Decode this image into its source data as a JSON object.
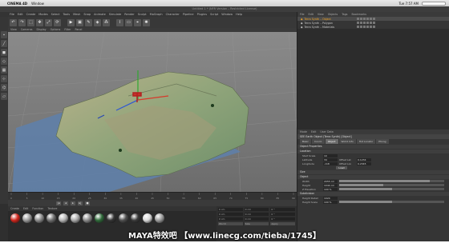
{
  "os_menubar": {
    "app_name": "CINEMA 4D",
    "menu": "Window",
    "time": "Tue 7:57 AM"
  },
  "window": {
    "title": "Untitled 1 * (NFR Version – Restricted License)"
  },
  "main_menu": [
    "File",
    "Edit",
    "Create",
    "Modes",
    "Select",
    "Tools",
    "Mesh",
    "Snap",
    "Animate",
    "Simulate",
    "Render",
    "Sculpt",
    "MoGraph",
    "Character",
    "Pipeline",
    "Plugins",
    "Script",
    "Window",
    "Help"
  ],
  "toolbar_icons": [
    "undo-icon",
    "redo-icon",
    "select-icon",
    "move-icon",
    "scale-icon",
    "rotate-icon",
    "render-icon",
    "cube-icon",
    "pen-icon",
    "subdivide-icon",
    "cloner-icon",
    "deformer-icon",
    "floor-icon",
    "camera-icon",
    "light-icon"
  ],
  "left_tools": [
    "points-icon",
    "edges-icon",
    "polygons-icon",
    "model-icon",
    "texture-icon",
    "axis-icon",
    "snap-icon",
    "workplane-icon"
  ],
  "viewport": {
    "menu": [
      "View",
      "Cameras",
      "Display",
      "Options",
      "Filter",
      "Panel"
    ],
    "label": "Perspective"
  },
  "timeline": {
    "ticks": [
      "0",
      "5",
      "10",
      "15",
      "20",
      "25",
      "30",
      "35",
      "40",
      "45",
      "50",
      "55",
      "60",
      "65",
      "70",
      "75",
      "80",
      "85",
      "90"
    ],
    "start": "0 F",
    "end": "90 F"
  },
  "materials": {
    "menu": [
      "Create",
      "Edit",
      "Function",
      "Texture"
    ],
    "colors": [
      "#d0251c",
      "#9a9a9a",
      "#8c8c8c",
      "#6f6f6f",
      "#b5b5b5",
      "#a8a8a8",
      "#8a8a8a",
      "#2f6a3a",
      "#343434",
      "#4f4f4f",
      "#3a3a3a",
      "#d8d8d8",
      "#9c9c9c"
    ]
  },
  "coordinates": {
    "rows": [
      [
        "0 cm",
        "0 cm",
        "0 °"
      ],
      [
        "0 cm",
        "0 cm",
        "0 °"
      ],
      [
        "0 cm",
        "0 cm",
        "0 °"
      ]
    ],
    "world_label": "World",
    "scale_label": "Size",
    "apply_label": "Apply"
  },
  "object_manager": {
    "menu": [
      "File",
      "Edit",
      "View",
      "Objects",
      "Tags",
      "Bookmarks"
    ],
    "objects": [
      {
        "name": "Terra Synth – Object",
        "selected": true
      },
      {
        "name": "Terra Synth – Polygon",
        "selected": false
      },
      {
        "name": "Terra Synth – Materials",
        "selected": false
      }
    ]
  },
  "attributes": {
    "menu": [
      "Mode",
      "Edit",
      "User Data"
    ],
    "header": "SEE Earth Object (Terra Synth) [Object]",
    "tabs": [
      "Basic",
      "Coord.",
      "Object",
      "World Info",
      "Hot Locator",
      "Phong"
    ],
    "active_tab": "Object",
    "sections": {
      "object_props": "Object Properties",
      "location": "Location",
      "size": "Size",
      "object": "Object",
      "subdivision": "Subdivision"
    },
    "fields": {
      "start_scale": [
        "Start Scale",
        "10"
      ],
      "latitude": [
        "Latitude",
        "34"
      ],
      "longitude": [
        "Longitude",
        "-118"
      ],
      "offset_lat": [
        "Offset Lat",
        "0.1234"
      ],
      "offset_lon": [
        "Offset Lon",
        "0.2345"
      ],
      "width": [
        "Width",
        "2055 cm"
      ],
      "height": [
        "Height",
        "1044 cm"
      ],
      "z_elevation": [
        "Z Elevation",
        "100 %"
      ],
      "height_detail": [
        "Height Detail",
        "1024"
      ],
      "height_scale": [
        "Height Scale",
        "100 %"
      ]
    },
    "load_button": "Load",
    "fill_levels": {
      "width": 0.86,
      "height": 0.42,
      "z_elevation": 0.5,
      "height_scale": 0.5
    }
  },
  "watermark": "MAYA特效吧 【www.linecg.com/tieba/1745】"
}
